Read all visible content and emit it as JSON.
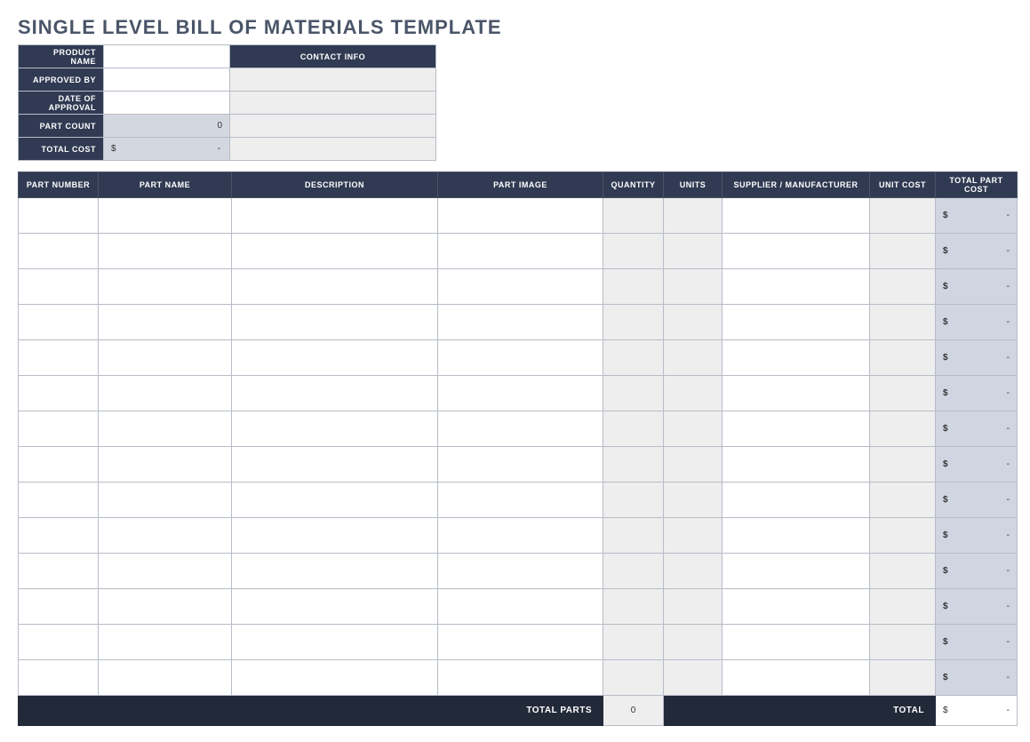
{
  "title": "SINGLE LEVEL BILL OF MATERIALS TEMPLATE",
  "summary": {
    "labels": {
      "product_name": "PRODUCT NAME",
      "approved_by": "APPROVED BY",
      "date_of_approval": "DATE OF APPROVAL",
      "part_count": "PART COUNT",
      "total_cost": "TOTAL COST",
      "contact_info": "CONTACT INFO"
    },
    "values": {
      "product_name": "",
      "approved_by": "",
      "date_of_approval": "",
      "part_count": "0",
      "total_cost_currency": "$",
      "total_cost_value": "-"
    },
    "contact": {
      "r1": "",
      "r2": "",
      "r3": "",
      "r4": ""
    }
  },
  "columns": {
    "part_number": "PART NUMBER",
    "part_name": "PART NAME",
    "description": "DESCRIPTION",
    "part_image": "PART IMAGE",
    "quantity": "QUANTITY",
    "units": "UNITS",
    "supplier": "SUPPLIER / MANUFACTURER",
    "unit_cost": "UNIT COST",
    "total_part_cost": "TOTAL PART COST"
  },
  "rows": [
    {
      "part_number": "",
      "part_name": "",
      "description": "",
      "part_image": "",
      "quantity": "",
      "units": "",
      "supplier": "",
      "unit_cost": "",
      "total_cur": "$",
      "total_val": "-"
    },
    {
      "part_number": "",
      "part_name": "",
      "description": "",
      "part_image": "",
      "quantity": "",
      "units": "",
      "supplier": "",
      "unit_cost": "",
      "total_cur": "$",
      "total_val": "-"
    },
    {
      "part_number": "",
      "part_name": "",
      "description": "",
      "part_image": "",
      "quantity": "",
      "units": "",
      "supplier": "",
      "unit_cost": "",
      "total_cur": "$",
      "total_val": "-"
    },
    {
      "part_number": "",
      "part_name": "",
      "description": "",
      "part_image": "",
      "quantity": "",
      "units": "",
      "supplier": "",
      "unit_cost": "",
      "total_cur": "$",
      "total_val": "-"
    },
    {
      "part_number": "",
      "part_name": "",
      "description": "",
      "part_image": "",
      "quantity": "",
      "units": "",
      "supplier": "",
      "unit_cost": "",
      "total_cur": "$",
      "total_val": "-"
    },
    {
      "part_number": "",
      "part_name": "",
      "description": "",
      "part_image": "",
      "quantity": "",
      "units": "",
      "supplier": "",
      "unit_cost": "",
      "total_cur": "$",
      "total_val": "-"
    },
    {
      "part_number": "",
      "part_name": "",
      "description": "",
      "part_image": "",
      "quantity": "",
      "units": "",
      "supplier": "",
      "unit_cost": "",
      "total_cur": "$",
      "total_val": "-"
    },
    {
      "part_number": "",
      "part_name": "",
      "description": "",
      "part_image": "",
      "quantity": "",
      "units": "",
      "supplier": "",
      "unit_cost": "",
      "total_cur": "$",
      "total_val": "-"
    },
    {
      "part_number": "",
      "part_name": "",
      "description": "",
      "part_image": "",
      "quantity": "",
      "units": "",
      "supplier": "",
      "unit_cost": "",
      "total_cur": "$",
      "total_val": "-"
    },
    {
      "part_number": "",
      "part_name": "",
      "description": "",
      "part_image": "",
      "quantity": "",
      "units": "",
      "supplier": "",
      "unit_cost": "",
      "total_cur": "$",
      "total_val": "-"
    },
    {
      "part_number": "",
      "part_name": "",
      "description": "",
      "part_image": "",
      "quantity": "",
      "units": "",
      "supplier": "",
      "unit_cost": "",
      "total_cur": "$",
      "total_val": "-"
    },
    {
      "part_number": "",
      "part_name": "",
      "description": "",
      "part_image": "",
      "quantity": "",
      "units": "",
      "supplier": "",
      "unit_cost": "",
      "total_cur": "$",
      "total_val": "-"
    },
    {
      "part_number": "",
      "part_name": "",
      "description": "",
      "part_image": "",
      "quantity": "",
      "units": "",
      "supplier": "",
      "unit_cost": "",
      "total_cur": "$",
      "total_val": "-"
    },
    {
      "part_number": "",
      "part_name": "",
      "description": "",
      "part_image": "",
      "quantity": "",
      "units": "",
      "supplier": "",
      "unit_cost": "",
      "total_cur": "$",
      "total_val": "-"
    }
  ],
  "footer": {
    "total_parts_label": "TOTAL PARTS",
    "total_parts_value": "0",
    "total_label": "TOTAL",
    "total_currency": "$",
    "total_value": "-"
  }
}
